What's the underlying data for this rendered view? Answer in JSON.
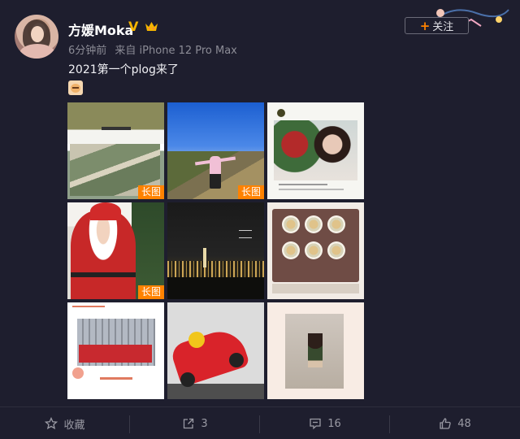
{
  "user": {
    "name": "方媛Moka",
    "verified_badge": "V",
    "time": "6分钟前",
    "source": "来自 iPhone 12 Pro Max",
    "follow_label": "关注"
  },
  "post": {
    "text": "2021第一个plog来了",
    "long_image_tag": "长图",
    "images": [
      {
        "label": "plog-image-1",
        "long": true
      },
      {
        "label": "plog-image-2",
        "long": true
      },
      {
        "label": "plog-image-3",
        "long": false
      },
      {
        "label": "plog-image-4",
        "long": true
      },
      {
        "label": "plog-image-5",
        "long": false
      },
      {
        "label": "plog-image-6",
        "long": false
      },
      {
        "label": "plog-image-7",
        "long": false
      },
      {
        "label": "plog-image-8",
        "long": false
      },
      {
        "label": "plog-image-9",
        "long": false
      }
    ]
  },
  "actions": {
    "favorite_label": "收藏",
    "repost_count": "3",
    "comment_count": "16",
    "like_count": "48"
  },
  "colors": {
    "background": "#1e1e2e",
    "accent": "#ff8200",
    "verified": "#f5b400"
  }
}
